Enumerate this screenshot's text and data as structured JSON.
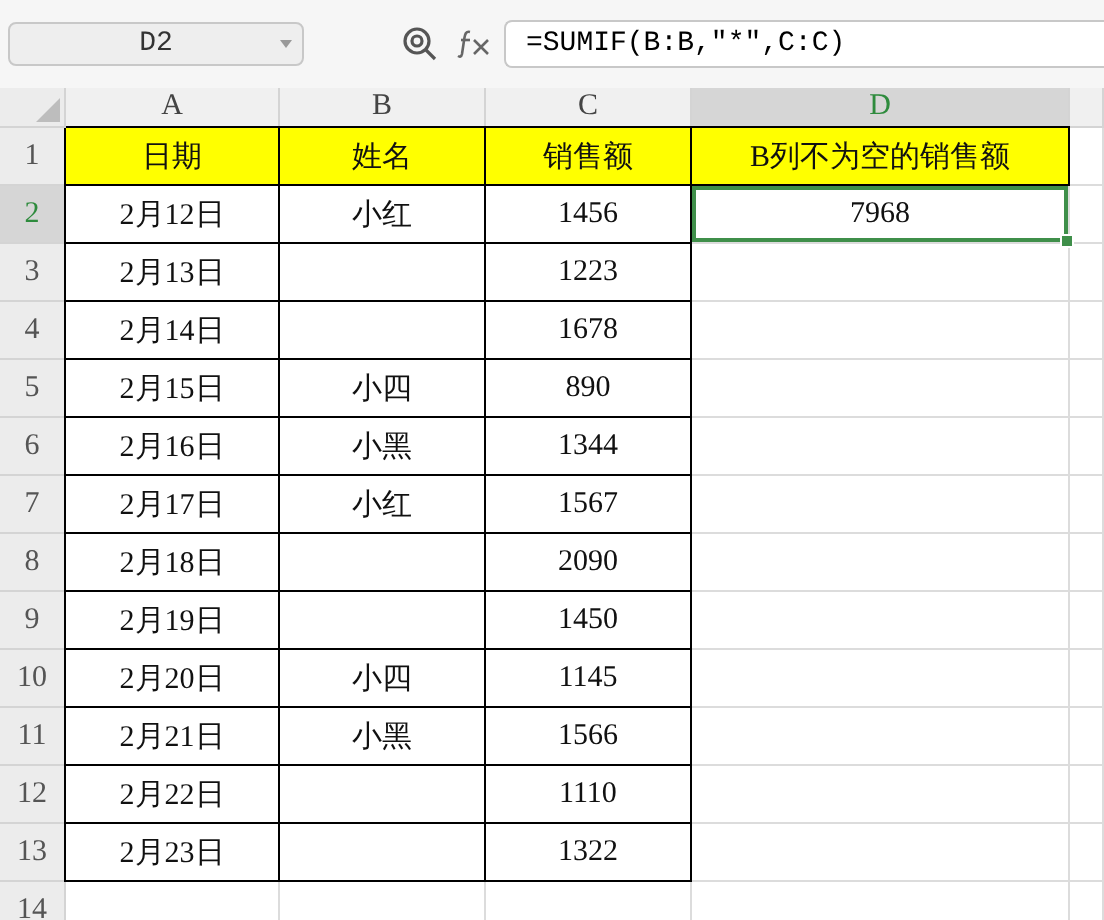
{
  "name_box": {
    "value": "D2"
  },
  "formula_bar": {
    "value": "=SUMIF(B:B,\"*\",C:C)"
  },
  "columns": [
    {
      "label": "A",
      "selected": false
    },
    {
      "label": "B",
      "selected": false
    },
    {
      "label": "C",
      "selected": false
    },
    {
      "label": "D",
      "selected": true
    }
  ],
  "rows": [
    {
      "number": "1",
      "selected": false,
      "cells": [
        {
          "text": "日期",
          "kind": "header",
          "selected": false
        },
        {
          "text": "姓名",
          "kind": "header",
          "selected": false
        },
        {
          "text": "销售额",
          "kind": "header",
          "selected": false
        },
        {
          "text": "B列不为空的销售额",
          "kind": "header",
          "selected": false
        }
      ]
    },
    {
      "number": "2",
      "selected": true,
      "cells": [
        {
          "text": "2月12日",
          "kind": "bordered",
          "selected": false
        },
        {
          "text": "小红",
          "kind": "bordered",
          "selected": false
        },
        {
          "text": "1456",
          "kind": "bordered",
          "selected": false
        },
        {
          "text": "7968",
          "kind": "plain",
          "selected": true
        }
      ]
    },
    {
      "number": "3",
      "selected": false,
      "cells": [
        {
          "text": "2月13日",
          "kind": "bordered",
          "selected": false
        },
        {
          "kind": "bordered",
          "selected": false
        },
        {
          "text": "1223",
          "kind": "bordered",
          "selected": false
        },
        {
          "kind": "plain",
          "selected": false
        }
      ]
    },
    {
      "number": "4",
      "selected": false,
      "cells": [
        {
          "text": "2月14日",
          "kind": "bordered",
          "selected": false
        },
        {
          "kind": "bordered",
          "selected": false
        },
        {
          "text": "1678",
          "kind": "bordered",
          "selected": false
        },
        {
          "kind": "plain",
          "selected": false
        }
      ]
    },
    {
      "number": "5",
      "selected": false,
      "cells": [
        {
          "text": "2月15日",
          "kind": "bordered",
          "selected": false
        },
        {
          "text": "小四",
          "kind": "bordered",
          "selected": false
        },
        {
          "text": "890",
          "kind": "bordered",
          "selected": false
        },
        {
          "kind": "plain",
          "selected": false
        }
      ]
    },
    {
      "number": "6",
      "selected": false,
      "cells": [
        {
          "text": "2月16日",
          "kind": "bordered",
          "selected": false
        },
        {
          "text": "小黑",
          "kind": "bordered",
          "selected": false
        },
        {
          "text": "1344",
          "kind": "bordered",
          "selected": false
        },
        {
          "kind": "plain",
          "selected": false
        }
      ]
    },
    {
      "number": "7",
      "selected": false,
      "cells": [
        {
          "text": "2月17日",
          "kind": "bordered",
          "selected": false
        },
        {
          "text": "小红",
          "kind": "bordered",
          "selected": false
        },
        {
          "text": "1567",
          "kind": "bordered",
          "selected": false
        },
        {
          "kind": "plain",
          "selected": false
        }
      ]
    },
    {
      "number": "8",
      "selected": false,
      "cells": [
        {
          "text": "2月18日",
          "kind": "bordered",
          "selected": false
        },
        {
          "kind": "bordered",
          "selected": false
        },
        {
          "text": "2090",
          "kind": "bordered",
          "selected": false
        },
        {
          "kind": "plain",
          "selected": false
        }
      ]
    },
    {
      "number": "9",
      "selected": false,
      "cells": [
        {
          "text": "2月19日",
          "kind": "bordered",
          "selected": false
        },
        {
          "kind": "bordered",
          "selected": false
        },
        {
          "text": "1450",
          "kind": "bordered",
          "selected": false
        },
        {
          "kind": "plain",
          "selected": false
        }
      ]
    },
    {
      "number": "10",
      "selected": false,
      "cells": [
        {
          "text": "2月20日",
          "kind": "bordered",
          "selected": false
        },
        {
          "text": "小四",
          "kind": "bordered",
          "selected": false
        },
        {
          "text": "1145",
          "kind": "bordered",
          "selected": false
        },
        {
          "kind": "plain",
          "selected": false
        }
      ]
    },
    {
      "number": "11",
      "selected": false,
      "cells": [
        {
          "text": "2月21日",
          "kind": "bordered",
          "selected": false
        },
        {
          "text": "小黑",
          "kind": "bordered",
          "selected": false
        },
        {
          "text": "1566",
          "kind": "bordered",
          "selected": false
        },
        {
          "kind": "plain",
          "selected": false
        }
      ]
    },
    {
      "number": "12",
      "selected": false,
      "cells": [
        {
          "text": "2月22日",
          "kind": "bordered",
          "selected": false
        },
        {
          "kind": "bordered",
          "selected": false
        },
        {
          "text": "1110",
          "kind": "bordered",
          "selected": false
        },
        {
          "kind": "plain",
          "selected": false
        }
      ]
    },
    {
      "number": "13",
      "selected": false,
      "cells": [
        {
          "text": "2月23日",
          "kind": "bordered",
          "selected": false
        },
        {
          "kind": "bordered",
          "selected": false
        },
        {
          "text": "1322",
          "kind": "bordered",
          "selected": false
        },
        {
          "kind": "plain",
          "selected": false
        }
      ]
    },
    {
      "number": "14",
      "selected": false,
      "cells": [
        {
          "kind": "plain",
          "selected": false
        },
        {
          "kind": "plain",
          "selected": false
        },
        {
          "kind": "plain",
          "selected": false
        },
        {
          "kind": "plain",
          "selected": false
        }
      ]
    }
  ]
}
